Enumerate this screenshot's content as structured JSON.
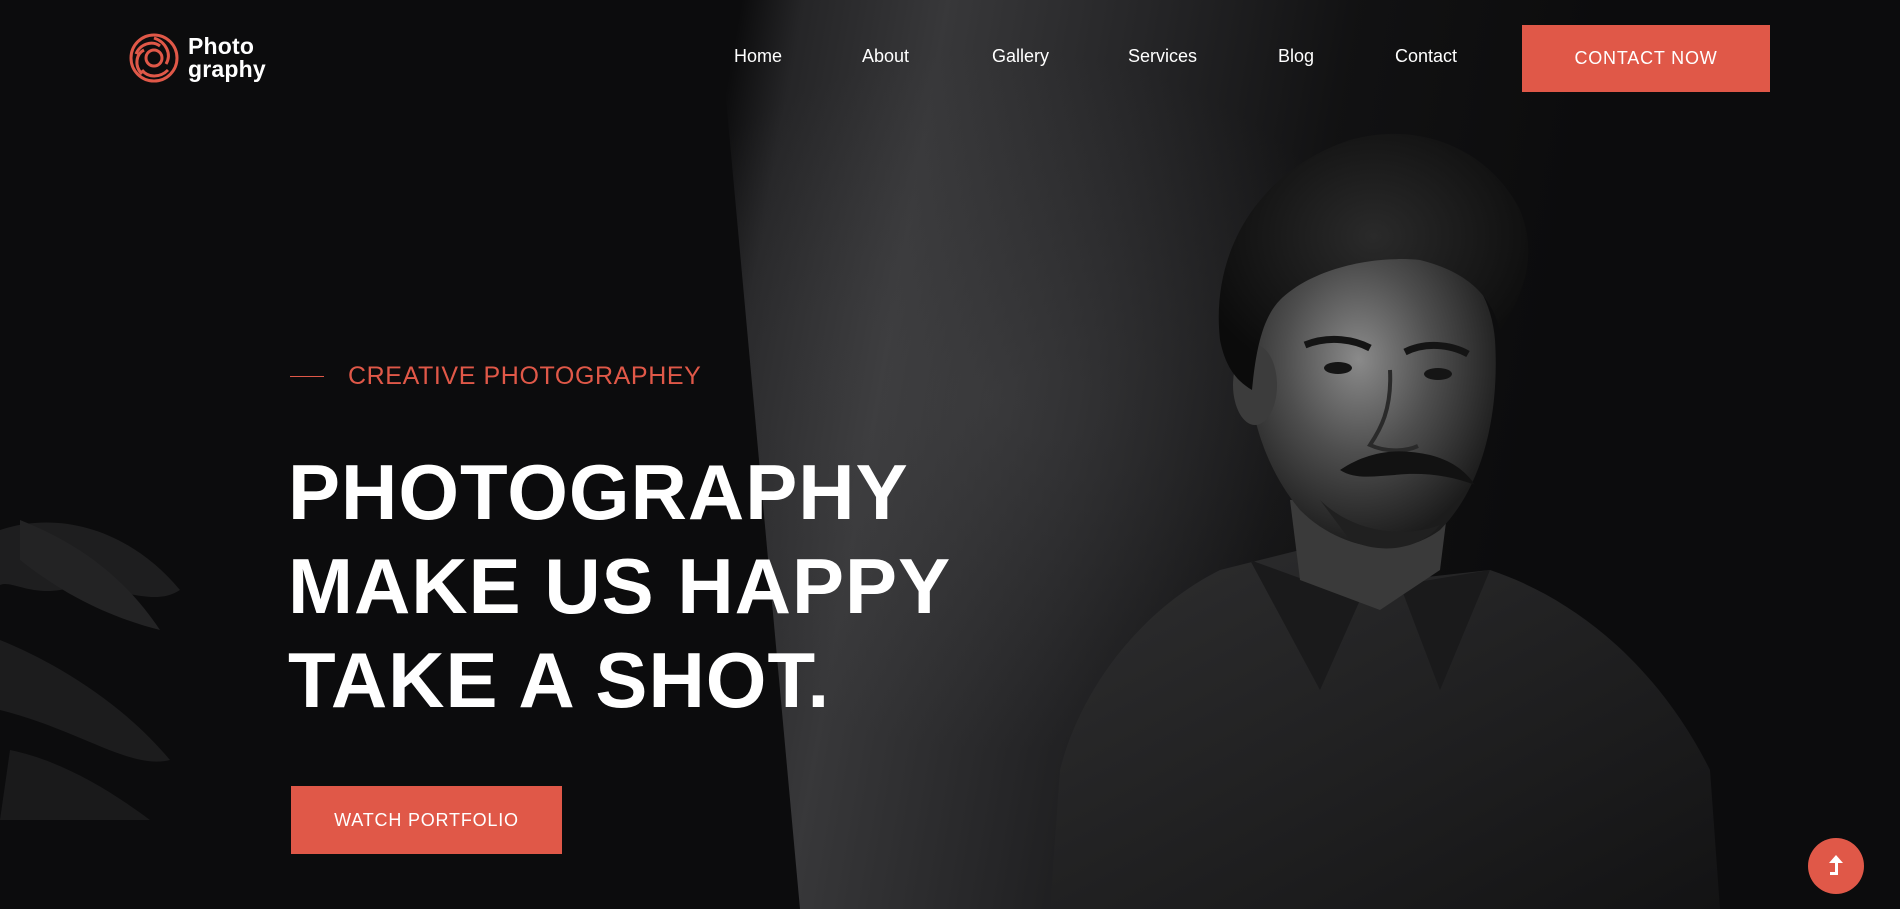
{
  "brand": {
    "line1": "Photo",
    "line2": "graphy",
    "accent_color": "#e05848",
    "logo_icon": "aperture-swirl-icon"
  },
  "nav": {
    "items": [
      {
        "label": "Home"
      },
      {
        "label": "About"
      },
      {
        "label": "Gallery"
      },
      {
        "label": "Services"
      },
      {
        "label": "Blog"
      },
      {
        "label": "Contact"
      }
    ],
    "cta_label": "CONTACT NOW"
  },
  "hero": {
    "eyebrow": "CREATIVE PHOTOGRAPHEY",
    "headline": [
      "PHOTOGRAPHY",
      "MAKE US HAPPY",
      "TAKE A SHOT."
    ],
    "button_label": "WATCH PORTFOLIO",
    "image": "portrait-photo"
  },
  "scroll_top": {
    "icon": "arrow-up-icon"
  }
}
